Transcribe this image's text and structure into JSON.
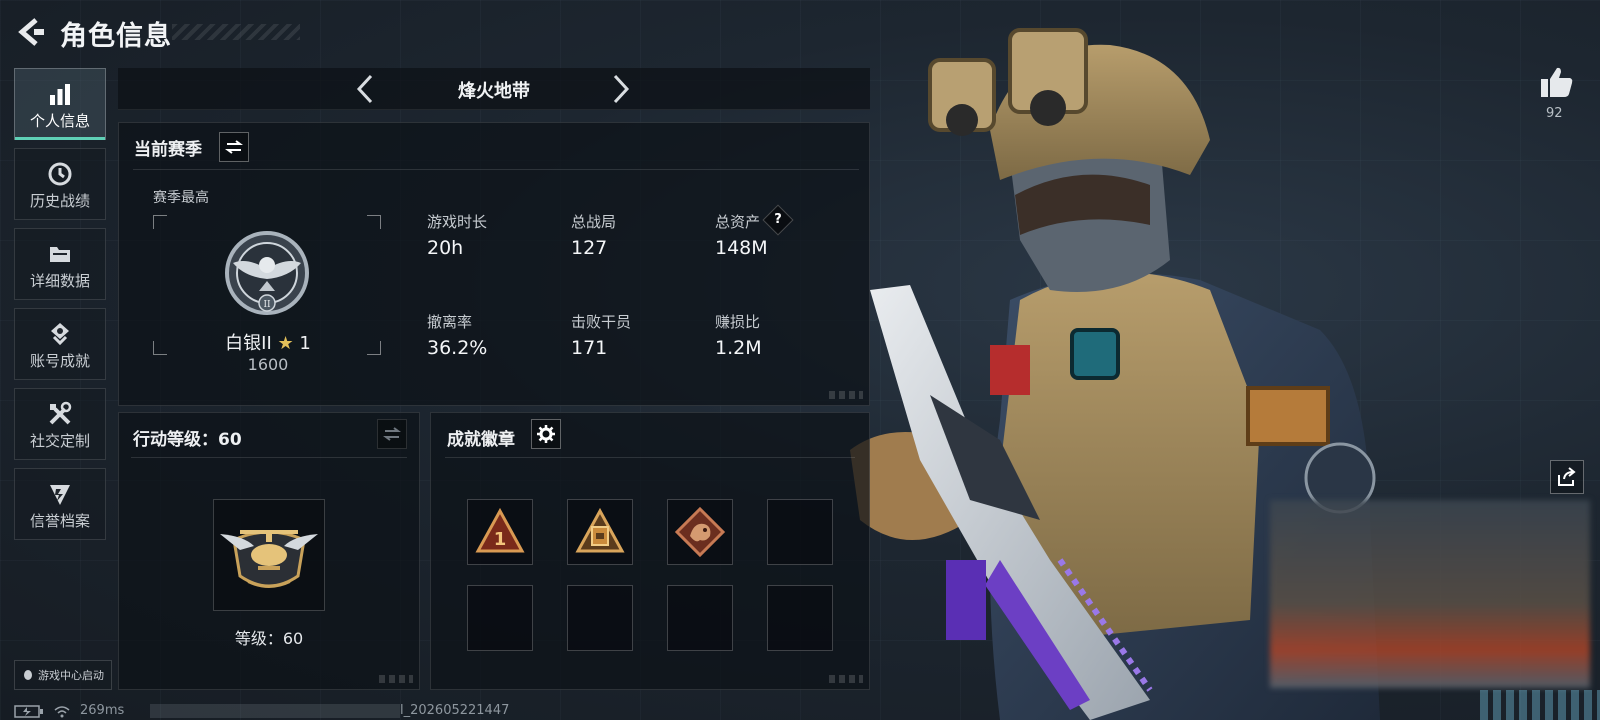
{
  "header": {
    "title": "角色信息",
    "back_icon": "back-arrow-icon"
  },
  "sidebar": {
    "items": [
      {
        "label": "个人信息",
        "icon": "bar-chart-icon",
        "active": true
      },
      {
        "label": "历史战绩",
        "icon": "history-clock-icon",
        "active": false
      },
      {
        "label": "详细数据",
        "icon": "folder-icon",
        "active": false
      },
      {
        "label": "账号成就",
        "icon": "achievement-icon",
        "active": false
      },
      {
        "label": "社交定制",
        "icon": "tools-icon",
        "active": false
      },
      {
        "label": "信誉档案",
        "icon": "credit-icon",
        "active": false
      }
    ],
    "game_center": "游戏中心启动"
  },
  "mode_selector": {
    "title": "烽火地带"
  },
  "season": {
    "title": "当前赛季",
    "best_label": "赛季最高",
    "rank_name": "白银II",
    "rank_stars": "1",
    "rank_points": "1600",
    "stats": [
      {
        "label": "游戏时长",
        "value": "20h"
      },
      {
        "label": "总战局",
        "value": "127"
      },
      {
        "label": "总资产",
        "value": "148M",
        "help": "?"
      },
      {
        "label": "撤离率",
        "value": "36.2%"
      },
      {
        "label": "击败干员",
        "value": "171"
      },
      {
        "label": "赚损比",
        "value": "1.2M"
      }
    ]
  },
  "action_level": {
    "title": "行动等级：60",
    "level_label": "等级：60"
  },
  "achievements": {
    "title": "成就徽章",
    "filled_slots": 3,
    "total_slots": 8
  },
  "right": {
    "like_count": "92"
  },
  "status_bar": {
    "ping": "269ms",
    "build_suffix": "l_202605221447"
  },
  "colors": {
    "accent": "#5fd0b6",
    "gold": "#c9a25a",
    "panel_bg": "#0d1218"
  }
}
